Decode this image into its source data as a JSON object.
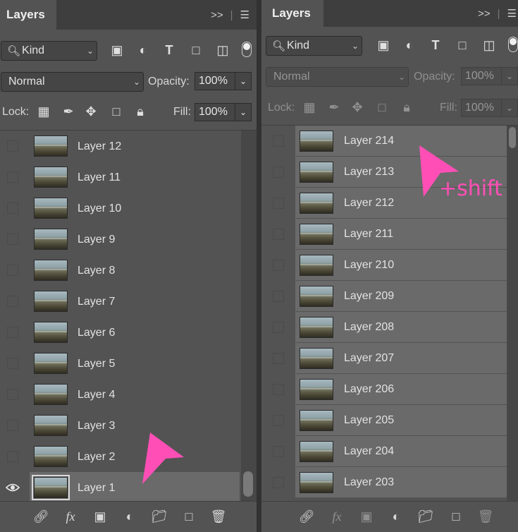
{
  "left": {
    "tab": "Layers",
    "filter_kind": "Kind",
    "blend_mode": "Normal",
    "opacity_label": "Opacity:",
    "opacity_value": "100%",
    "lock_label": "Lock:",
    "fill_label": "Fill:",
    "fill_value": "100%",
    "layers": [
      {
        "name": "Layer 12",
        "visible": false
      },
      {
        "name": "Layer 11",
        "visible": false
      },
      {
        "name": "Layer 10",
        "visible": false
      },
      {
        "name": "Layer 9",
        "visible": false
      },
      {
        "name": "Layer 8",
        "visible": false
      },
      {
        "name": "Layer 7",
        "visible": false
      },
      {
        "name": "Layer 6",
        "visible": false
      },
      {
        "name": "Layer 5",
        "visible": false
      },
      {
        "name": "Layer 4",
        "visible": false
      },
      {
        "name": "Layer 3",
        "visible": false
      },
      {
        "name": "Layer 2",
        "visible": false
      },
      {
        "name": "Layer 1",
        "visible": true,
        "selected": true
      }
    ]
  },
  "right": {
    "tab": "Layers",
    "filter_kind": "Kind",
    "blend_mode": "Normal",
    "opacity_label": "Opacity:",
    "opacity_value": "100%",
    "lock_label": "Lock:",
    "fill_label": "Fill:",
    "fill_value": "100%",
    "annotation": "+shift",
    "layers": [
      {
        "name": "Layer 214",
        "selected": true
      },
      {
        "name": "Layer 213",
        "selected": true
      },
      {
        "name": "Layer 212",
        "selected": true
      },
      {
        "name": "Layer 211",
        "selected": true
      },
      {
        "name": "Layer 210",
        "selected": true
      },
      {
        "name": "Layer 209",
        "selected": true
      },
      {
        "name": "Layer 208",
        "selected": true
      },
      {
        "name": "Layer 207",
        "selected": true
      },
      {
        "name": "Layer 206",
        "selected": true
      },
      {
        "name": "Layer 205",
        "selected": true
      },
      {
        "name": "Layer 204",
        "selected": true
      },
      {
        "name": "Layer 203",
        "selected": true
      }
    ]
  },
  "icons": {
    "tab_menu": ">>",
    "menu": "hamburger-icon",
    "fx": "fx"
  },
  "colors": {
    "panel": "#535353",
    "selected_row": "#6a6a6a",
    "annotation": "#ff4fb6"
  }
}
